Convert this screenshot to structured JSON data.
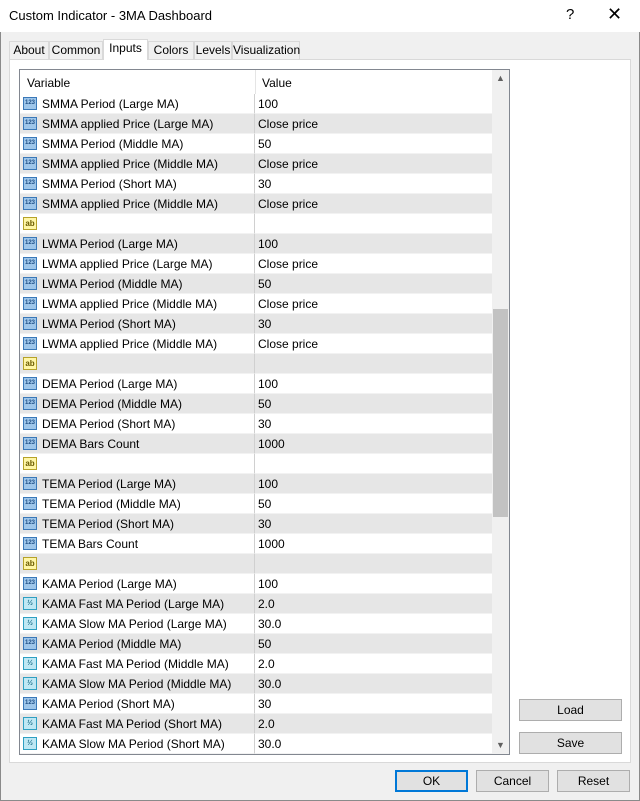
{
  "window": {
    "title": "Custom Indicator - 3MA Dashboard",
    "help_glyph": "?",
    "close_glyph": "✕"
  },
  "tabs": [
    {
      "label": "About"
    },
    {
      "label": "Common"
    },
    {
      "label": "Inputs"
    },
    {
      "label": "Colors"
    },
    {
      "label": "Levels"
    },
    {
      "label": "Visualization"
    }
  ],
  "active_tab": "Inputs",
  "grid": {
    "header": {
      "variable": "Variable",
      "value": "Value"
    },
    "rows": [
      {
        "icon": "int",
        "icon_text": "123",
        "name": "SMMA Period (Large MA)",
        "value": "100"
      },
      {
        "icon": "int",
        "icon_text": "123",
        "name": "SMMA applied Price (Large MA)",
        "value": "Close price"
      },
      {
        "icon": "int",
        "icon_text": "123",
        "name": "SMMA Period (Middle MA)",
        "value": "50"
      },
      {
        "icon": "int",
        "icon_text": "123",
        "name": "SMMA applied Price (Middle MA)",
        "value": "Close price"
      },
      {
        "icon": "int",
        "icon_text": "123",
        "name": "SMMA Period (Short MA)",
        "value": "30"
      },
      {
        "icon": "int",
        "icon_text": "123",
        "name": "SMMA applied Price (Middle MA)",
        "value": "Close price"
      },
      {
        "icon": "str",
        "icon_text": "ab",
        "name": "",
        "value": ""
      },
      {
        "icon": "int",
        "icon_text": "123",
        "name": "LWMA Period (Large MA)",
        "value": "100"
      },
      {
        "icon": "int",
        "icon_text": "123",
        "name": "LWMA applied Price (Large MA)",
        "value": "Close price"
      },
      {
        "icon": "int",
        "icon_text": "123",
        "name": "LWMA Period (Middle MA)",
        "value": "50"
      },
      {
        "icon": "int",
        "icon_text": "123",
        "name": "LWMA applied Price (Middle MA)",
        "value": "Close price"
      },
      {
        "icon": "int",
        "icon_text": "123",
        "name": "LWMA Period (Short MA)",
        "value": "30"
      },
      {
        "icon": "int",
        "icon_text": "123",
        "name": "LWMA applied Price (Middle MA)",
        "value": "Close price"
      },
      {
        "icon": "str",
        "icon_text": "ab",
        "name": "",
        "value": ""
      },
      {
        "icon": "int",
        "icon_text": "123",
        "name": "DEMA Period (Large MA)",
        "value": "100"
      },
      {
        "icon": "int",
        "icon_text": "123",
        "name": "DEMA Period (Middle MA)",
        "value": "50"
      },
      {
        "icon": "int",
        "icon_text": "123",
        "name": "DEMA Period (Short MA)",
        "value": "30"
      },
      {
        "icon": "int",
        "icon_text": "123",
        "name": "DEMA Bars Count",
        "value": "1000"
      },
      {
        "icon": "str",
        "icon_text": "ab",
        "name": "",
        "value": ""
      },
      {
        "icon": "int",
        "icon_text": "123",
        "name": "TEMA Period (Large MA)",
        "value": "100"
      },
      {
        "icon": "int",
        "icon_text": "123",
        "name": "TEMA Period (Middle MA)",
        "value": "50"
      },
      {
        "icon": "int",
        "icon_text": "123",
        "name": "TEMA Period (Short MA)",
        "value": "30"
      },
      {
        "icon": "int",
        "icon_text": "123",
        "name": "TEMA Bars Count",
        "value": "1000"
      },
      {
        "icon": "str",
        "icon_text": "ab",
        "name": "",
        "value": ""
      },
      {
        "icon": "int",
        "icon_text": "123",
        "name": "KAMA Period (Large MA)",
        "value": "100"
      },
      {
        "icon": "dbl",
        "icon_text": "½",
        "name": "KAMA Fast MA Period (Large MA)",
        "value": "2.0"
      },
      {
        "icon": "dbl",
        "icon_text": "½",
        "name": "KAMA Slow MA Period (Large MA)",
        "value": "30.0"
      },
      {
        "icon": "int",
        "icon_text": "123",
        "name": "KAMA Period (Middle MA)",
        "value": "50"
      },
      {
        "icon": "dbl",
        "icon_text": "½",
        "name": "KAMA Fast MA Period (Middle MA)",
        "value": "2.0"
      },
      {
        "icon": "dbl",
        "icon_text": "½",
        "name": "KAMA Slow MA Period (Middle MA)",
        "value": "30.0"
      },
      {
        "icon": "int",
        "icon_text": "123",
        "name": "KAMA Period (Short MA)",
        "value": "30"
      },
      {
        "icon": "dbl",
        "icon_text": "½",
        "name": "KAMA Fast MA Period (Short MA)",
        "value": "2.0"
      },
      {
        "icon": "dbl",
        "icon_text": "½",
        "name": "KAMA Slow MA Period (Short MA)",
        "value": "30.0"
      }
    ]
  },
  "side_buttons": {
    "load": "Load",
    "save": "Save"
  },
  "footer_buttons": {
    "ok": "OK",
    "cancel": "Cancel",
    "reset": "Reset"
  },
  "scrollbar": {
    "up_glyph": "▲",
    "down_glyph": "▼"
  },
  "colors": {
    "accent": "#0078d7",
    "row_shade": "#e6e6e6"
  }
}
